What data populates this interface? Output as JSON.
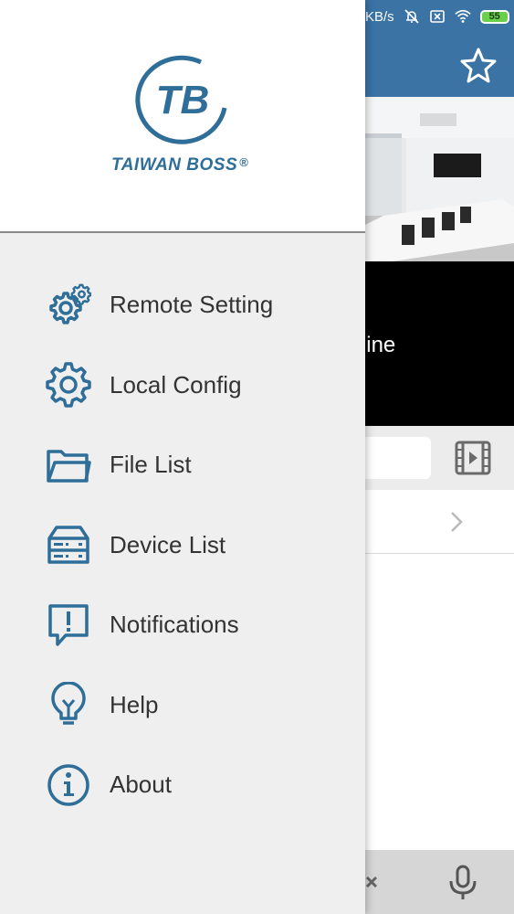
{
  "status_bar": {
    "speed": "KB/s",
    "battery": "55"
  },
  "camera": {
    "status_text": "ffline"
  },
  "drawer": {
    "logo_monogram": "TB",
    "brand_name": "TAIWAN BOSS",
    "brand_mark": "®",
    "menu": [
      {
        "label": "Remote Setting",
        "icon": "gears-icon"
      },
      {
        "label": "Local Config",
        "icon": "gear-icon"
      },
      {
        "label": "File List",
        "icon": "folder-icon"
      },
      {
        "label": "Device List",
        "icon": "device-icon"
      },
      {
        "label": "Notifications",
        "icon": "alert-message-icon"
      },
      {
        "label": "Help",
        "icon": "lightbulb-icon"
      },
      {
        "label": "About",
        "icon": "info-icon"
      }
    ]
  },
  "colors": {
    "accent": "#3a73a4",
    "icon_blue": "#2f6e98",
    "drawer_bg": "#efefef",
    "text": "#333333"
  }
}
